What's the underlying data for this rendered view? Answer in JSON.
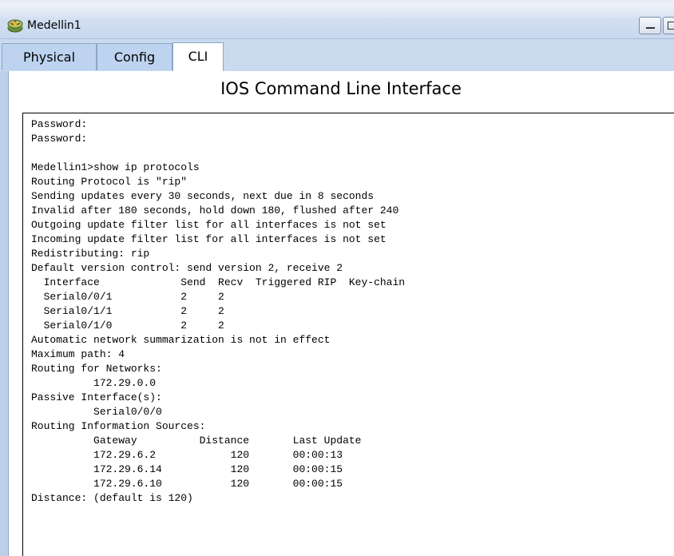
{
  "window": {
    "title": "Medellin1",
    "icon": "router-icon"
  },
  "tabs": [
    {
      "label": "Physical",
      "selected": false
    },
    {
      "label": "Config",
      "selected": false
    },
    {
      "label": "CLI",
      "selected": true
    }
  ],
  "panel": {
    "title": "IOS Command Line Interface"
  },
  "terminal": {
    "lines": [
      "Password:",
      "Password:",
      "",
      "Medellin1>show ip protocols",
      "Routing Protocol is \"rip\"",
      "Sending updates every 30 seconds, next due in 8 seconds",
      "Invalid after 180 seconds, hold down 180, flushed after 240",
      "Outgoing update filter list for all interfaces is not set",
      "Incoming update filter list for all interfaces is not set",
      "Redistributing: rip",
      "Default version control: send version 2, receive 2",
      "  Interface             Send  Recv  Triggered RIP  Key-chain",
      "  Serial0/0/1           2     2",
      "  Serial0/1/1           2     2",
      "  Serial0/1/0           2     2",
      "Automatic network summarization is not in effect",
      "Maximum path: 4",
      "Routing for Networks:",
      "          172.29.0.0",
      "Passive Interface(s):",
      "          Serial0/0/0",
      "Routing Information Sources:",
      "          Gateway          Distance       Last Update",
      "          172.29.6.2            120       00:00:13",
      "          172.29.6.14           120       00:00:15",
      "          172.29.6.10           120       00:00:15",
      "Distance: (default is 120)"
    ]
  }
}
